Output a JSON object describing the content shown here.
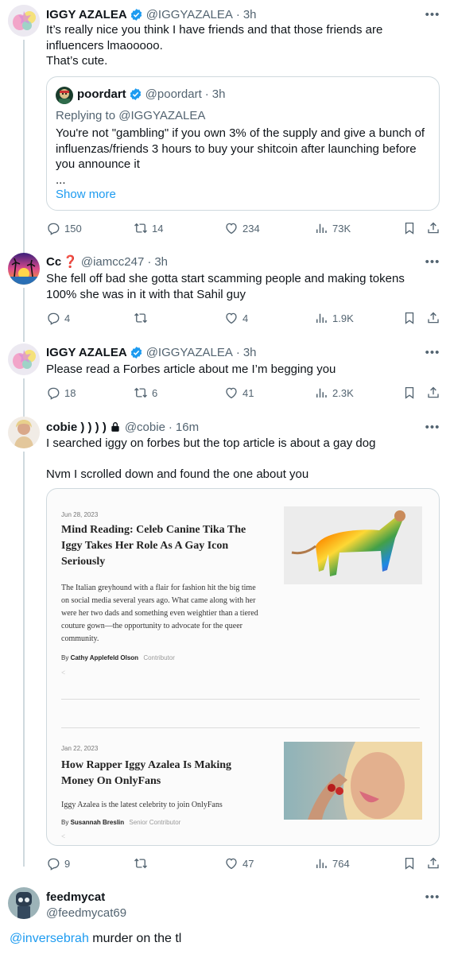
{
  "tweets": [
    {
      "name": "IGGY AZALEA",
      "handle": "@IGGYAZALEA",
      "time": "3h",
      "text": "It’s really nice you think I have friends and that those friends are influencers lmaooooo.\nThat’s cute.",
      "quote": {
        "name": "poordart",
        "handle": "@poordart",
        "time": "3h",
        "reply_to": "Replying to @IGGYAZALEA",
        "text": "You're not \"gambling\" if you own 3% of the supply and give a bunch of influenzas/friends 3 hours to buy your shitcoin after launching before you announce it\n...",
        "show_more": "Show more"
      },
      "replies": "150",
      "retweets": "14",
      "likes": "234",
      "views": "73K"
    },
    {
      "name": "Cc",
      "name_emoji": "❓",
      "handle": "@iamcc247",
      "time": "3h",
      "text": "She fell off bad she gotta start scamming people and making tokens 100% she was in it with that Sahil guy",
      "replies": "4",
      "retweets": "",
      "likes": "4",
      "views": "1.9K"
    },
    {
      "name": "IGGY AZALEA",
      "handle": "@IGGYAZALEA",
      "time": "3h",
      "text": "Please read a Forbes article about me I’m begging you",
      "replies": "18",
      "retweets": "6",
      "likes": "41",
      "views": "2.3K"
    },
    {
      "name": "cobie ) ) ) )",
      "handle": "@cobie",
      "time": "16m",
      "text": "I searched iggy on forbes but the top article is about a gay dog\n\nNvm I scrolled down and found the one about you",
      "articles": [
        {
          "date": "Jun 28, 2023",
          "title": "Mind Reading: Celeb Canine Tika The Iggy Takes Her Role As A Gay Icon Seriously",
          "desc": "The Italian greyhound with a flair for fashion hit the big time on social media several years ago. What came along with her were her two dads and something even weightier than a tiered couture gown—the opportunity to advocate for the queer community.",
          "by": "By",
          "author": "Cathy Applefeld Olson",
          "role": "Contributor"
        },
        {
          "date": "Jan 22, 2023",
          "title": "How Rapper Iggy Azalea Is Making Money On OnlyFans",
          "desc": "Iggy Azalea is the latest celebrity to join OnlyFans",
          "by": "By",
          "author": "Susannah Breslin",
          "role": "Senior Contributor"
        }
      ],
      "replies": "9",
      "retweets": "",
      "likes": "47",
      "views": "764"
    },
    {
      "name": "feedmycat",
      "handle": "@feedmycat69",
      "mention": "@inversebrah",
      "text": " murder on the tl"
    }
  ],
  "icons": {
    "reply": "reply-icon",
    "retweet": "retweet-icon",
    "like": "heart-icon",
    "views": "views-icon",
    "bookmark": "bookmark-icon",
    "share": "share-icon",
    "verified": "verified-badge-icon",
    "more": "more-icon",
    "lock": "lock-icon"
  },
  "colors": {
    "accent": "#1d9bf0",
    "muted": "#536471",
    "text": "#0f1419",
    "border": "#cfd9de"
  }
}
